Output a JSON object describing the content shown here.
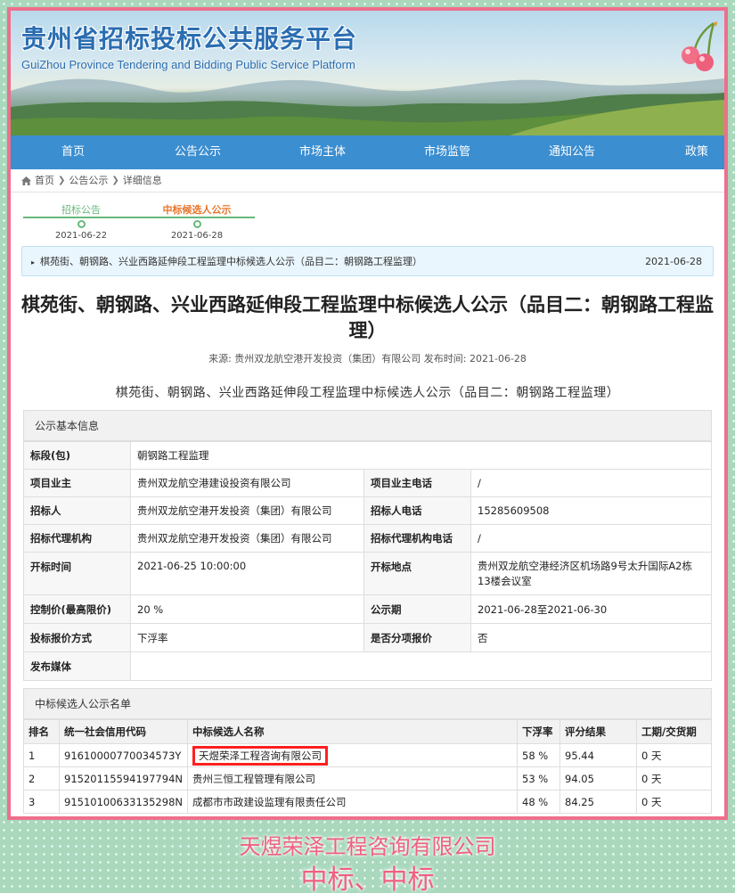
{
  "header": {
    "title": "贵州省招标投标公共服务平台",
    "subtitle": "GuiZhou Province Tendering and Bidding Public Service Platform"
  },
  "nav": [
    "首页",
    "公告公示",
    "市场主体",
    "市场监管",
    "通知公告",
    "政策"
  ],
  "breadcrumb": [
    "首页",
    "公告公示",
    "详细信息"
  ],
  "timeline": [
    {
      "label": "招标公告",
      "date": "2021-06-22"
    },
    {
      "label": "中标候选人公示",
      "date": "2021-06-28"
    }
  ],
  "notice": {
    "text": "棋苑街、朝钢路、兴业西路延伸段工程监理中标候选人公示（品目二：朝钢路工程监理）",
    "date": "2021-06-28"
  },
  "article": {
    "title": "棋苑街、朝钢路、兴业西路延伸段工程监理中标候选人公示（品目二：朝钢路工程监理）",
    "meta": "来源: 贵州双龙航空港开发投资（集团）有限公司    发布时间: 2021-06-28",
    "subtitle": "棋苑街、朝钢路、兴业西路延伸段工程监理中标候选人公示（品目二：朝钢路工程监理）"
  },
  "basic": {
    "heading": "公示基本信息",
    "section_label": "标段(包)",
    "section_value": "朝钢路工程监理",
    "owner_label": "项目业主",
    "owner_value": "贵州双龙航空港建设投资有限公司",
    "owner_phone_label": "项目业主电话",
    "owner_phone_value": "/",
    "tenderer_label": "招标人",
    "tenderer_value": "贵州双龙航空港开发投资（集团）有限公司",
    "tenderer_phone_label": "招标人电话",
    "tenderer_phone_value": "15285609508",
    "agency_label": "招标代理机构",
    "agency_value": "贵州双龙航空港开发投资（集团）有限公司",
    "agency_phone_label": "招标代理机构电话",
    "agency_phone_value": "/",
    "open_time_label": "开标时间",
    "open_time_value": "2021-06-25 10:00:00",
    "open_place_label": "开标地点",
    "open_place_value": "贵州双龙航空港经济区机场路9号太升国际A2栋13楼会议室",
    "control_label": "控制价(最高限价)",
    "control_value": "20 %",
    "period_label": "公示期",
    "period_value": "2021-06-28至2021-06-30",
    "quote_label": "投标报价方式",
    "quote_value": "下浮率",
    "split_label": "是否分项报价",
    "split_value": "否",
    "media_label": "发布媒体",
    "media_value": ""
  },
  "candidates": {
    "heading": "中标候选人公示名单",
    "columns": [
      "排名",
      "统一社会信用代码",
      "中标候选人名称",
      "下浮率",
      "评分结果",
      "工期/交货期"
    ],
    "rows": [
      {
        "rank": "1",
        "code": "91610000770034573Y",
        "name": "天煜荣泽工程咨询有限公司",
        "rate": "58 %",
        "score": "95.44",
        "period": "0 天"
      },
      {
        "rank": "2",
        "code": "91520115594197794N",
        "name": "贵州三恒工程管理有限公司",
        "rate": "53 %",
        "score": "94.05",
        "period": "0 天"
      },
      {
        "rank": "3",
        "code": "91510100633135298N",
        "name": "成都市市政建设监理有限责任公司",
        "rate": "48 %",
        "score": "84.25",
        "period": "0 天"
      }
    ]
  },
  "overlay": {
    "line1": "天煜荣泽工程咨询有限公司",
    "line2": "中标、中标"
  },
  "colors": {
    "nav": "#3b8ed0",
    "frame": "#ef6f8c",
    "accent_orange": "#e8742a",
    "accent_green": "#67b97b",
    "highlight": "#ff2020"
  },
  "icons": [
    "home-icon",
    "chevron-right-icon",
    "cherry-logo"
  ]
}
